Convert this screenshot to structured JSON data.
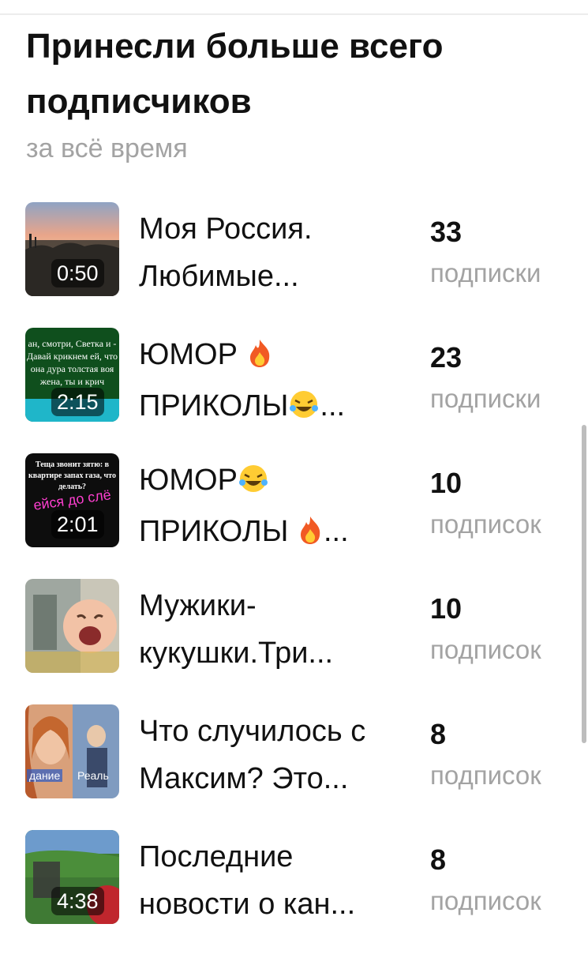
{
  "header": {
    "title": "Принесли больше всего подписчиков",
    "subtitle": "за всё время"
  },
  "videos": [
    {
      "thumb_icon": "sunset-landscape-thumbnail",
      "duration": "0:50",
      "title_line1": "Моя Россия.",
      "title_line2": "Любимые...",
      "count": "33",
      "count_label": "подписки"
    },
    {
      "thumb_icon": "text-story-thumbnail",
      "thumb_text": "ан, смотри, Светка и - Давай крикнем ей, что она дура толстая воя жена, ты и крич",
      "duration": "2:15",
      "title_line1": "ЮМОР",
      "title_line1_emoji": "fire-emoji",
      "title_line2": "ПРИКОЛЫ",
      "title_line2_emoji": "laughing-emoji",
      "title_line2_tail": "...",
      "count": "23",
      "count_label": "подписки"
    },
    {
      "thumb_icon": "joke-text-thumbnail",
      "thumb_text": "Теща звонит зятю: в квартире запах газа, что делать?",
      "thumb_highlight": "ейся до слё",
      "duration": "2:01",
      "title_line1": "ЮМОР",
      "title_line1_emoji": "laughing-emoji",
      "title_line2": "ПРИКОЛЫ ",
      "title_line2_emoji": "fire-emoji",
      "title_line2_tail": "...",
      "count": "10",
      "count_label": "подписок"
    },
    {
      "thumb_icon": "banknote-baby-thumbnail",
      "duration": "",
      "title_line1": "Мужики-",
      "title_line2": "кукушки.Три...",
      "count": "10",
      "count_label": "подписок"
    },
    {
      "thumb_icon": "woman-portrait-thumbnail",
      "thumb_caption_left": "дание",
      "thumb_caption_right": "Реаль",
      "duration": "",
      "title_line1": "Что случилось с",
      "title_line2": "Максим? Это...",
      "count": "8",
      "count_label": "подписок"
    },
    {
      "thumb_icon": "dog-grass-thumbnail",
      "duration": "4:38",
      "title_line1": "Последние",
      "title_line2": "новости о кан...",
      "count": "8",
      "count_label": "подписок"
    }
  ],
  "colors": {
    "text": "#111111",
    "muted": "#a3a3a3",
    "fire": "#f15a24",
    "laugh": "#ffcc33"
  }
}
